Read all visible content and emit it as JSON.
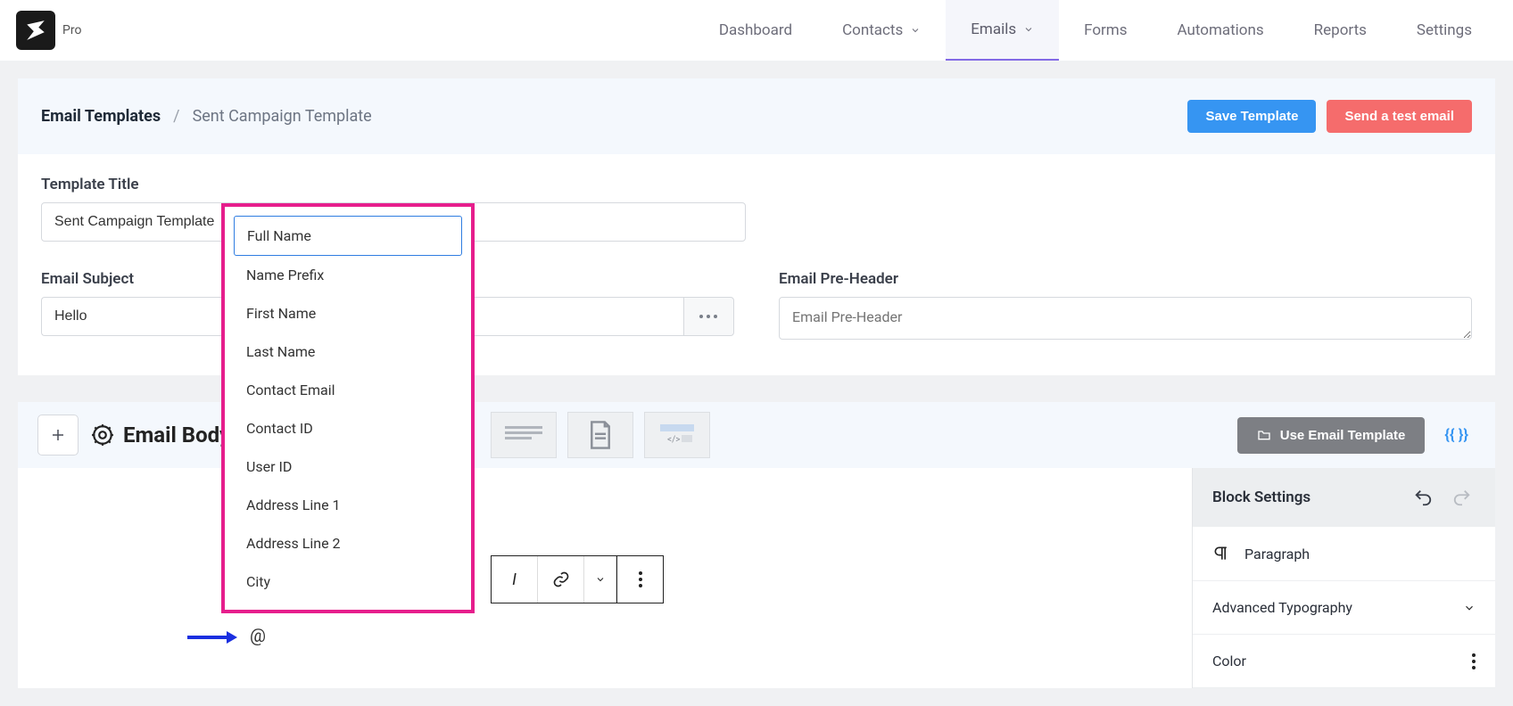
{
  "brand": {
    "pro": "Pro"
  },
  "nav": {
    "dashboard": "Dashboard",
    "contacts": "Contacts",
    "emails": "Emails",
    "forms": "Forms",
    "automations": "Automations",
    "reports": "Reports",
    "settings": "Settings"
  },
  "breadcrumb": {
    "root": "Email Templates",
    "current": "Sent Campaign Template"
  },
  "actions": {
    "save": "Save Template",
    "sendTest": "Send a test email"
  },
  "fields": {
    "titleLabel": "Template Title",
    "titleValue": "Sent Campaign Template",
    "subjectLabel": "Email Subject",
    "subjectValue": "Hello",
    "preheaderLabel": "Email Pre-Header",
    "preheaderPlaceholder": "Email Pre-Header"
  },
  "bodyBar": {
    "title": "Email Body",
    "useTemplate": "Use Email Template"
  },
  "sidebar": {
    "title": "Block Settings",
    "paragraph": "Paragraph",
    "advTypo": "Advanced Typography",
    "color": "Color"
  },
  "dropdown": {
    "items": [
      "Full Name",
      "Name Prefix",
      "First Name",
      "Last Name",
      "Contact Email",
      "Contact ID",
      "User ID",
      "Address Line 1",
      "Address Line 2",
      "City"
    ]
  },
  "canvas": {
    "at": "@"
  }
}
